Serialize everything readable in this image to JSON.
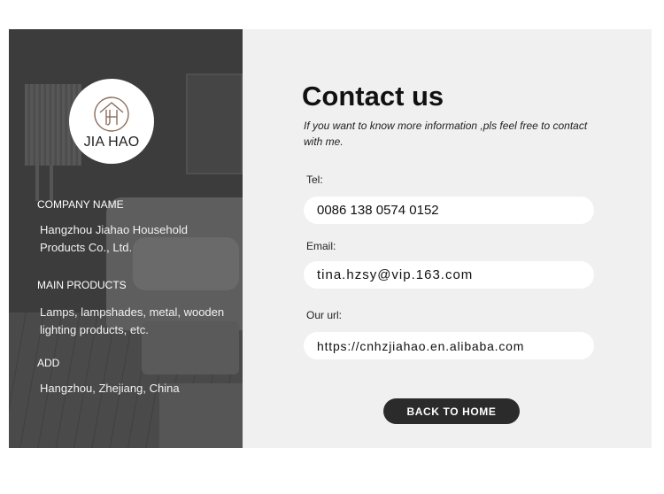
{
  "logo": {
    "text": "JIA HAO",
    "monogram": "JH"
  },
  "company": {
    "name_label": "COMPANY NAME",
    "name_line1": "Hangzhou Jiahao Household",
    "name_line2": "Products Co., Ltd.",
    "products_label": "MAIN PRODUCTS",
    "products_line1": "Lamps, lampshades, metal, wooden",
    "products_line2": "lighting products, etc.",
    "address_label": "ADD",
    "address_value": "Hangzhou, Zhejiang, China"
  },
  "contact": {
    "title": "Contact us",
    "subtitle_line1": "If you want to know more information ,pls feel free to contact",
    "subtitle_line2": "with me.",
    "tel_label": "Tel:",
    "tel_value": "0086 138 0574 0152",
    "email_label": "Email:",
    "email_value": "tina.hzsy@vip.163.com",
    "url_label": "Our url:",
    "url_value": "https://cnhzjiahao.en.alibaba.com"
  },
  "actions": {
    "back_home_label": "BACK TO HOME"
  },
  "colors": {
    "left_panel_bg": "#444444",
    "right_panel_bg": "#f0f0f0",
    "button_bg": "#2b2b2b",
    "logo_mark": "#8a6d5a"
  }
}
